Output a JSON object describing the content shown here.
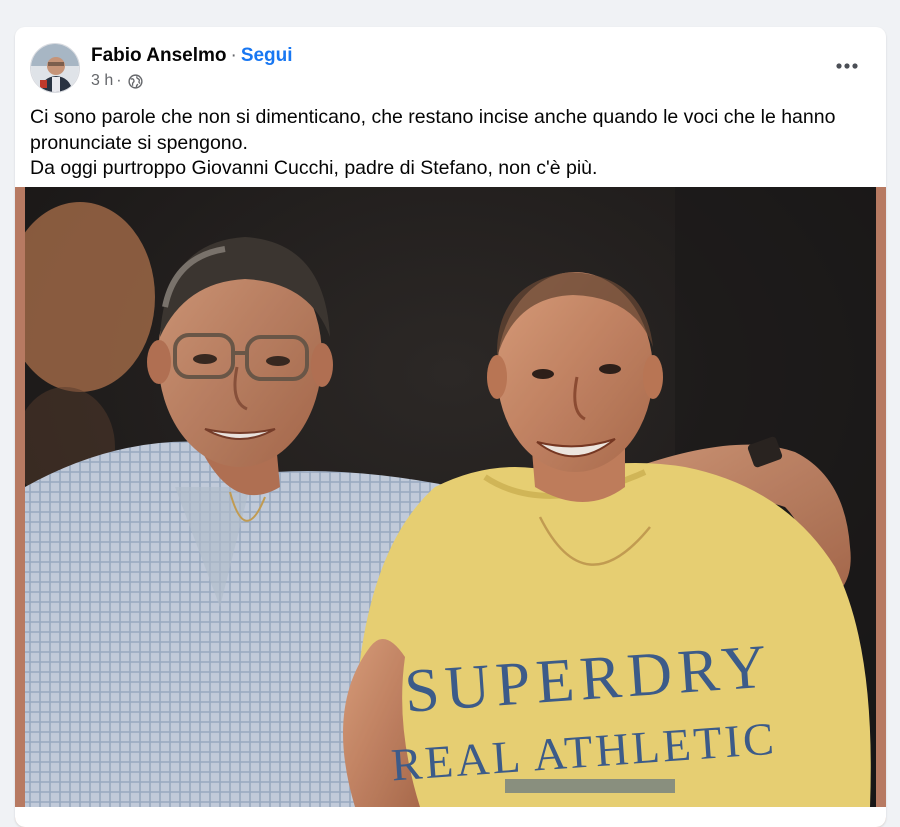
{
  "post": {
    "author": "Fabio Anselmo",
    "separator": "·",
    "follow_label": "Segui",
    "time": "3 h",
    "time_separator": "·",
    "privacy_icon": "globe-icon",
    "more_icon": "more-options-icon",
    "text_lines": [
      "Ci sono parole che non si dimenticano, che restano incise anche quando le voci che le hanno pronunciate si spengono.",
      "Da oggi purtroppo Giovanni Cucchi, padre di Stefano, non c'è più."
    ],
    "photo": {
      "shirt_text_line1": "SUPERDRY",
      "shirt_text_line2": "REAL ATHLETIC"
    }
  },
  "colors": {
    "page_bg": "#f0f2f5",
    "card_bg": "#ffffff",
    "link": "#1877f2",
    "secondary_text": "#65676b",
    "photo_border": "#b77a62"
  }
}
